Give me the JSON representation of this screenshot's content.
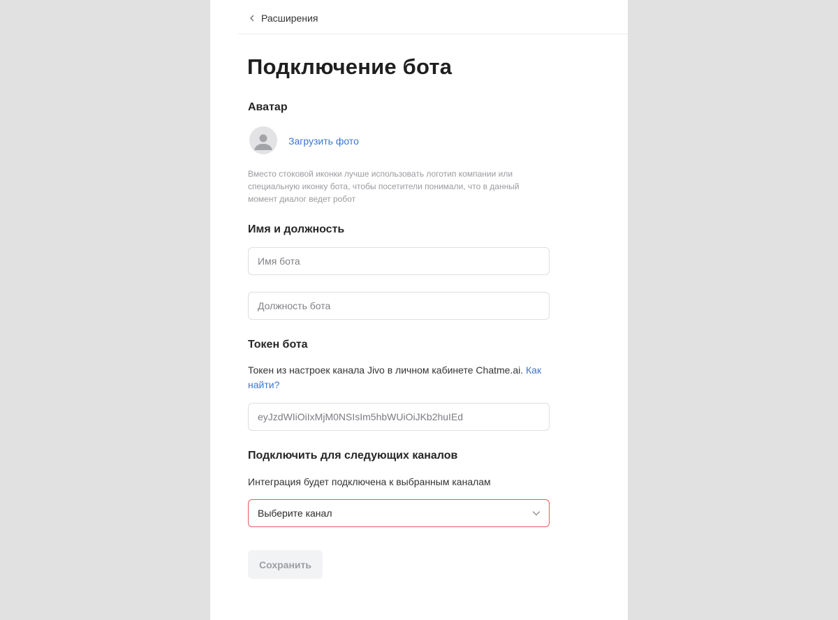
{
  "colors": {
    "accent": "#3a76d0",
    "error_border": "#e85a5a",
    "background": "#e1e1e1",
    "panel": "#ffffff"
  },
  "breadcrumb": {
    "back_label": "Расширения",
    "back_icon": "chevron-left-icon"
  },
  "page": {
    "title": "Подключение бота"
  },
  "avatar_section": {
    "title": "Аватар",
    "placeholder_icon": "user-avatar-icon",
    "upload_label": "Загрузить фото",
    "hint": "Вместо стоковой иконки лучше использовать логотип компании или специальную иконку бота, чтобы посетители понимали, что в данный момент диалог ведет робот"
  },
  "name_section": {
    "title": "Имя и должность",
    "name_placeholder": "Имя бота",
    "name_value": "",
    "position_placeholder": "Должность бота",
    "position_value": ""
  },
  "token_section": {
    "title": "Токен бота",
    "description": "Токен из настроек канала Jivo в личном кабинете Chatme.ai.",
    "help_link": "Как найти?",
    "token_value": "eyJzdWIiOiIxMjM0NSIsIm5hbWUiOiJKb2huIEd"
  },
  "channels_section": {
    "title": "Подключить для следующих каналов",
    "description": "Интеграция будет подключена к выбранным каналам",
    "select_value": "Выберите канал",
    "select_icon": "chevron-down-icon"
  },
  "actions": {
    "save_label": "Сохранить",
    "save_disabled": true
  }
}
